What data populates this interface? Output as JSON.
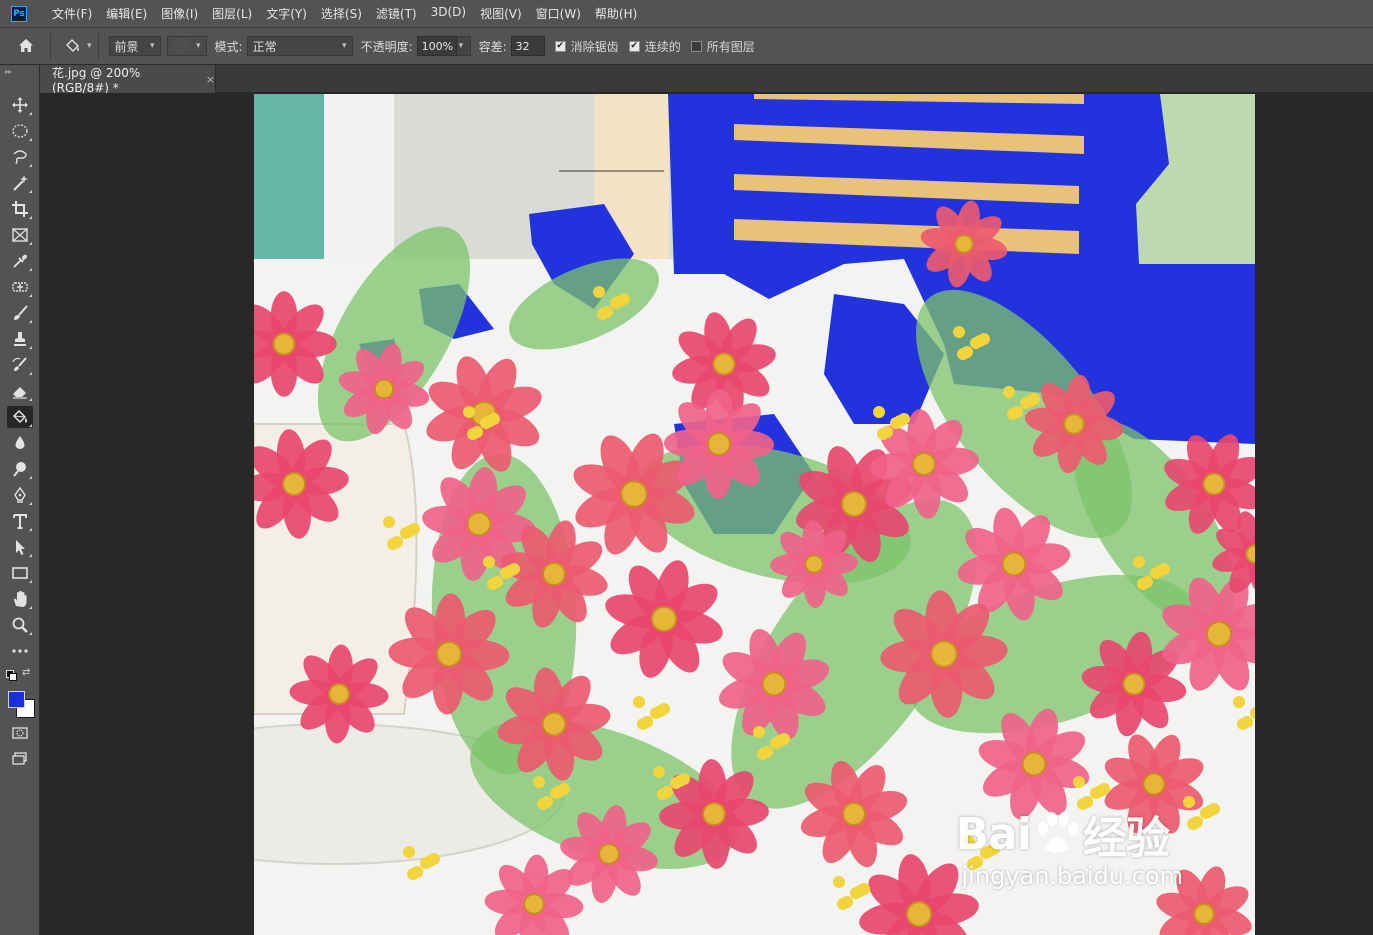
{
  "app": {
    "logo": "Ps"
  },
  "menu": [
    "文件(F)",
    "编辑(E)",
    "图像(I)",
    "图层(L)",
    "文字(Y)",
    "选择(S)",
    "滤镜(T)",
    "3D(D)",
    "视图(V)",
    "窗口(W)",
    "帮助(H)"
  ],
  "options": {
    "fill_source": "前景",
    "mode_label": "模式:",
    "mode_value": "正常",
    "opacity_label": "不透明度:",
    "opacity_value": "100%",
    "tolerance_label": "容差:",
    "tolerance_value": "32",
    "antialias_label": "消除锯齿",
    "antialias_checked": true,
    "contiguous_label": "连续的",
    "contiguous_checked": true,
    "all_layers_label": "所有图层",
    "all_layers_checked": false
  },
  "document_tab": {
    "title": "花.jpg @ 200%(RGB/8#) *",
    "close": "×"
  },
  "tools": [
    {
      "name": "move-tool-icon"
    },
    {
      "name": "elliptical-marquee-tool-icon"
    },
    {
      "name": "lasso-tool-icon"
    },
    {
      "name": "magic-wand-tool-icon"
    },
    {
      "name": "crop-tool-icon"
    },
    {
      "name": "frame-tool-icon"
    },
    {
      "name": "eyedropper-tool-icon"
    },
    {
      "name": "healing-brush-tool-icon"
    },
    {
      "name": "brush-tool-icon"
    },
    {
      "name": "clone-stamp-tool-icon"
    },
    {
      "name": "history-brush-tool-icon"
    },
    {
      "name": "eraser-tool-icon"
    },
    {
      "name": "paint-bucket-tool-icon",
      "active": true
    },
    {
      "name": "blur-tool-icon"
    },
    {
      "name": "dodge-tool-icon"
    },
    {
      "name": "pen-tool-icon"
    },
    {
      "name": "type-tool-icon"
    },
    {
      "name": "path-selection-tool-icon"
    },
    {
      "name": "rectangle-tool-icon"
    },
    {
      "name": "hand-tool-icon"
    },
    {
      "name": "zoom-tool-icon"
    },
    {
      "name": "more-tools-icon"
    }
  ],
  "colors": {
    "foreground": "#1c2fde",
    "background": "#ffffff",
    "accent_fill": "#2233dd"
  },
  "watermark": {
    "brand_left": "Bai",
    "brand_right": "经验",
    "url": "jingyan.baidu.com"
  }
}
